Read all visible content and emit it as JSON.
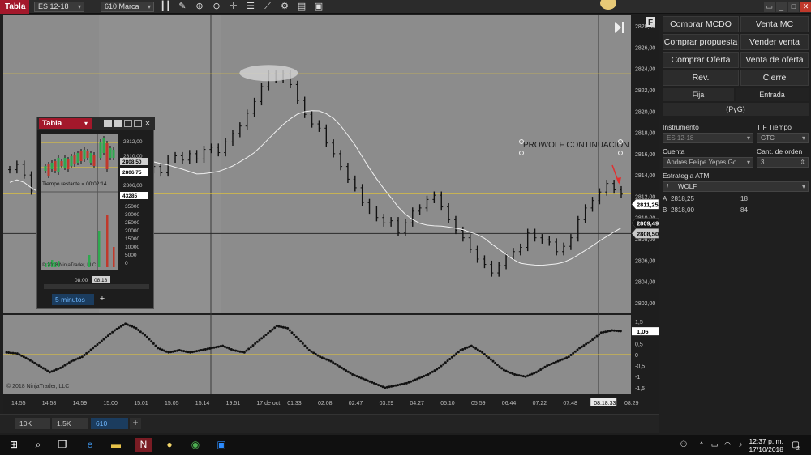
{
  "toolbar": {
    "tab": "Tabla",
    "instrument": "ES 12-18",
    "bar_type": "610 Marca"
  },
  "chart": {
    "watermark": "© 2018 NinjaTrader, LLC",
    "annotation": "PROWOLF CONTINUACION",
    "f_button": "F",
    "price_ticks": [
      "2828,00",
      "2826,00",
      "2824,00",
      "2822,00",
      "2820,00",
      "2818,00",
      "2816,00",
      "2814,00",
      "2812,00",
      "2810,00",
      "2808,00",
      "2806,00",
      "2804,00",
      "2802,00"
    ],
    "price_tags": [
      {
        "label": "2811,25",
        "value": 2811.25,
        "style": "white"
      },
      {
        "label": "2809,49",
        "value": 2809.49,
        "style": "dark"
      },
      {
        "label": "2808,50",
        "value": 2808.5,
        "style": "grey"
      }
    ],
    "time_ticks": [
      "14:55",
      "14:58",
      "14:59",
      "15:00",
      "15:01",
      "15:05",
      "15:14",
      "19:51",
      "17 de oct.",
      "01:33",
      "02:08",
      "02:47",
      "03:29",
      "04:27",
      "05:10",
      "05:59",
      "06:44",
      "07:22",
      "07:48",
      "08:18:33",
      "08:29"
    ],
    "osc_ticks": [
      "1,5",
      "1",
      "0,5",
      "0",
      "-0,5",
      "-1",
      "-1,5"
    ],
    "osc_tag": "1,06",
    "horizontal_lines": [
      2823.5,
      2812.25,
      2808.5
    ]
  },
  "chart_data": {
    "type": "line",
    "title": "",
    "price": {
      "y_range": [
        2801,
        2829
      ],
      "close": [
        2814.5,
        2815,
        2814,
        2812.5,
        2812,
        2813,
        2813.5,
        2813,
        2814.5,
        2815.5,
        2816,
        2817,
        2818,
        2817.5,
        2818.5,
        2818,
        2816,
        2815.5,
        2815,
        2814.5,
        2814.8,
        2814.2,
        2815.5,
        2815.8,
        2815.4,
        2816,
        2815.5,
        2816.4,
        2816.6,
        2816.1,
        2817.1,
        2817.9,
        2818.6,
        2819.8,
        2820.9,
        2822.3,
        2823.5,
        2823,
        2823.5,
        2822.5,
        2821,
        2819.7,
        2818.8,
        2818.4,
        2817,
        2816,
        2814.8,
        2813.6,
        2812.8,
        2811.4,
        2810.7,
        2810,
        2809.5,
        2809.7,
        2808.6,
        2809.5,
        2810.6,
        2810.9,
        2811.7,
        2812.1,
        2811,
        2809.8,
        2808.8,
        2808.1,
        2807,
        2806.1,
        2805.6,
        2804.8,
        2805.5,
        2806.3,
        2806.8,
        2807.2,
        2808.6,
        2808.1,
        2807.9,
        2807.7,
        2806.8,
        2807.3,
        2808.1,
        2809.8,
        2810.9,
        2811.6,
        2812.4,
        2813.2,
        2812.6,
        2812.2
      ]
    },
    "oscillator": {
      "y_range": [
        -1.8,
        1.8
      ],
      "values": [
        0.1,
        0.05,
        -0.2,
        -0.5,
        -0.8,
        -0.6,
        -0.3,
        -0.1,
        0.3,
        0.7,
        1.1,
        1.4,
        1.2,
        0.8,
        0.3,
        0.1,
        0.2,
        0.1,
        0.2,
        0.3,
        0.4,
        0.2,
        0.1,
        0.5,
        0.9,
        1.3,
        1.2,
        0.7,
        0.2,
        -0.1,
        -0.3,
        -0.6,
        -0.9,
        -1.1,
        -1.3,
        -1.5,
        -1.4,
        -1.3,
        -1.1,
        -0.9,
        -0.6,
        -0.2,
        0.2,
        0.4,
        0.1,
        -0.3,
        -0.7,
        -0.9,
        -1.0,
        -0.8,
        -0.5,
        -0.3,
        -0.1,
        0.3,
        0.6,
        1.0,
        1.1,
        1.06
      ]
    }
  },
  "order_panel": {
    "buttons": [
      "Comprar MCDO",
      "Venta MC",
      "Comprar propuesta",
      "Vender venta",
      "Comprar Oferta",
      "Venta de oferta",
      "Rev.",
      "Cierre"
    ],
    "tabs": [
      "Fija",
      "Entrada"
    ],
    "pnl": "(PyG)",
    "instrument_label": "Instrumento",
    "instrument_value": "ES 12-18",
    "tif_label": "TIF Tiempo vigente",
    "tif_value": "GTC",
    "account_label": "Cuenta",
    "account_value": "Andres Felipe Yepes Go...",
    "qty_label": "Cant. de orden",
    "qty_value": "3",
    "atm_label": "Estrategia ATM",
    "atm_info": "i",
    "atm_value": "WOLF",
    "levels": [
      {
        "label": "A",
        "price": "2818,25",
        "qty": "18"
      },
      {
        "label": "B",
        "price": "2818,00",
        "qty": "84"
      }
    ]
  },
  "bottom_tabs": [
    "10K",
    "1.5K",
    "610"
  ],
  "float_window": {
    "tab": "Tabla",
    "time_left": "Tiempo restante = 00:02:14",
    "watermark": "© 2018 NinjaTrader, LLC",
    "price_ticks": [
      "2812,00",
      "2810,00",
      "2808,00",
      "2806,00"
    ],
    "price_tags": [
      "2808,50",
      "2806,75"
    ],
    "volume_tag": "43285",
    "volume_ticks": [
      "35000",
      "30000",
      "25000",
      "20000",
      "15000",
      "10000",
      "5000",
      "0"
    ],
    "time_ticks": [
      "08:00",
      "08:18"
    ],
    "period_tab": "5 minutos"
  },
  "taskbar": {
    "time": "12:37 p. m.",
    "date": "17/10/2018",
    "notif_count": "2"
  },
  "colors": {
    "chart_bg": "#8c8c8c",
    "level_line": "#e8c833",
    "brand_red": "#a3182b",
    "price_tag_up": "#ffffff"
  }
}
